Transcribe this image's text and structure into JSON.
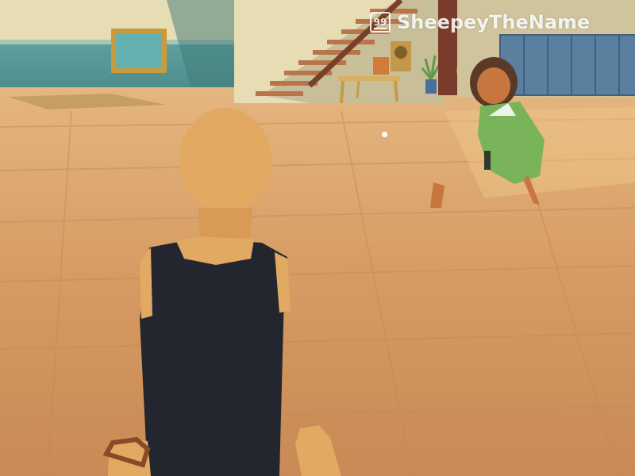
{
  "nameplate": {
    "level": "99",
    "player_name": "SheepeyTheName"
  },
  "crosshair": {
    "icon": "dot-reticle"
  },
  "colors": {
    "floor": "#d69a62",
    "wall_teal": "#5fa5a3",
    "wall_cream": "#e7ddb4",
    "shirt": "#23262e",
    "skin": "#e2a962",
    "jacket": "#79b35a",
    "lockers": "#5b7f9f"
  }
}
